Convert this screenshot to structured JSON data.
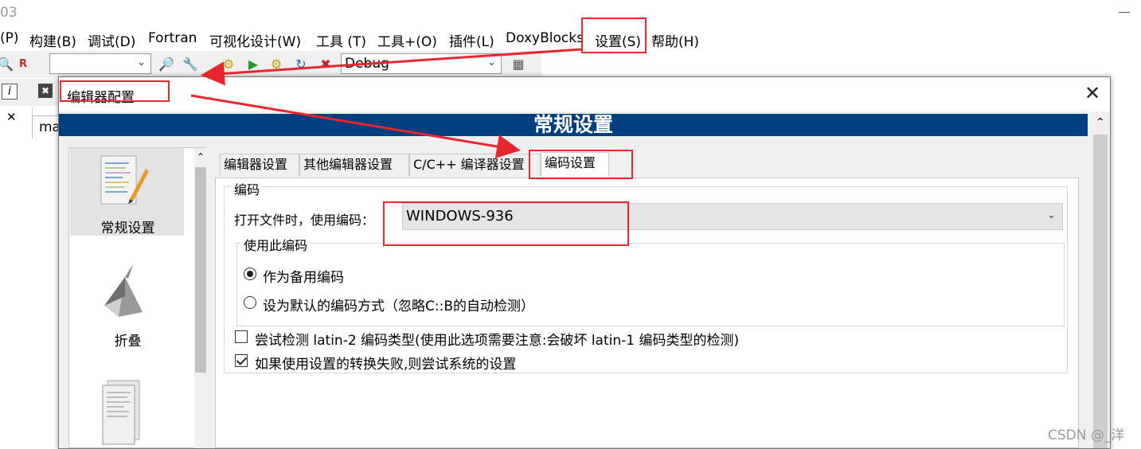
{
  "window": {
    "title_fragment": "03"
  },
  "menubar": {
    "items": [
      "(P)",
      "构建(B)",
      "调试(D)",
      "Fortran",
      "可视化设计(W)",
      "工具 (T)",
      "工具+(O)",
      "插件(L)",
      "DoxyBlocks",
      "设置(S)",
      "帮助(H)"
    ]
  },
  "toolbar": {
    "build_target": "Debug"
  },
  "editor": {
    "tab_label": "ma"
  },
  "dialog": {
    "title": "编辑器配置",
    "header": "常规设置",
    "categories": [
      {
        "label": "常规设置",
        "icon": "general-settings-icon",
        "selected": true
      },
      {
        "label": "折叠",
        "icon": "fold-icon",
        "selected": false
      },
      {
        "label": "",
        "icon": "document-icon",
        "selected": false
      }
    ],
    "tabs": [
      {
        "label": "编辑器设置",
        "active": false
      },
      {
        "label": "其他编辑器设置",
        "active": false
      },
      {
        "label": "C/C++ 编译器设置",
        "active": false
      },
      {
        "label": "编码设置",
        "active": true
      }
    ],
    "encoding": {
      "group_label": "编码",
      "open_label": "打开文件时，使用编码：",
      "selected_encoding": "WINDOWS-936",
      "use_group_label": "使用此编码",
      "options": [
        {
          "label": "作为备用编码",
          "checked": true
        },
        {
          "label": "设为默认的编码方式（忽略C::B的自动检测）",
          "checked": false
        }
      ],
      "checkboxes": [
        {
          "label": "尝试检测 latin-2 编码类型(使用此选项需要注意:会破坏 latin-1 编码类型的检测)",
          "checked": false
        },
        {
          "label": "如果使用设置的转换失败,则尝试系统的设置",
          "checked": true
        }
      ]
    }
  },
  "annotation": {
    "color": "#e8262d"
  },
  "watermark": "CSDN @_洋",
  "colors": {
    "header_bg": "#003e7e",
    "dialog_bg": "#f0f0f0"
  }
}
